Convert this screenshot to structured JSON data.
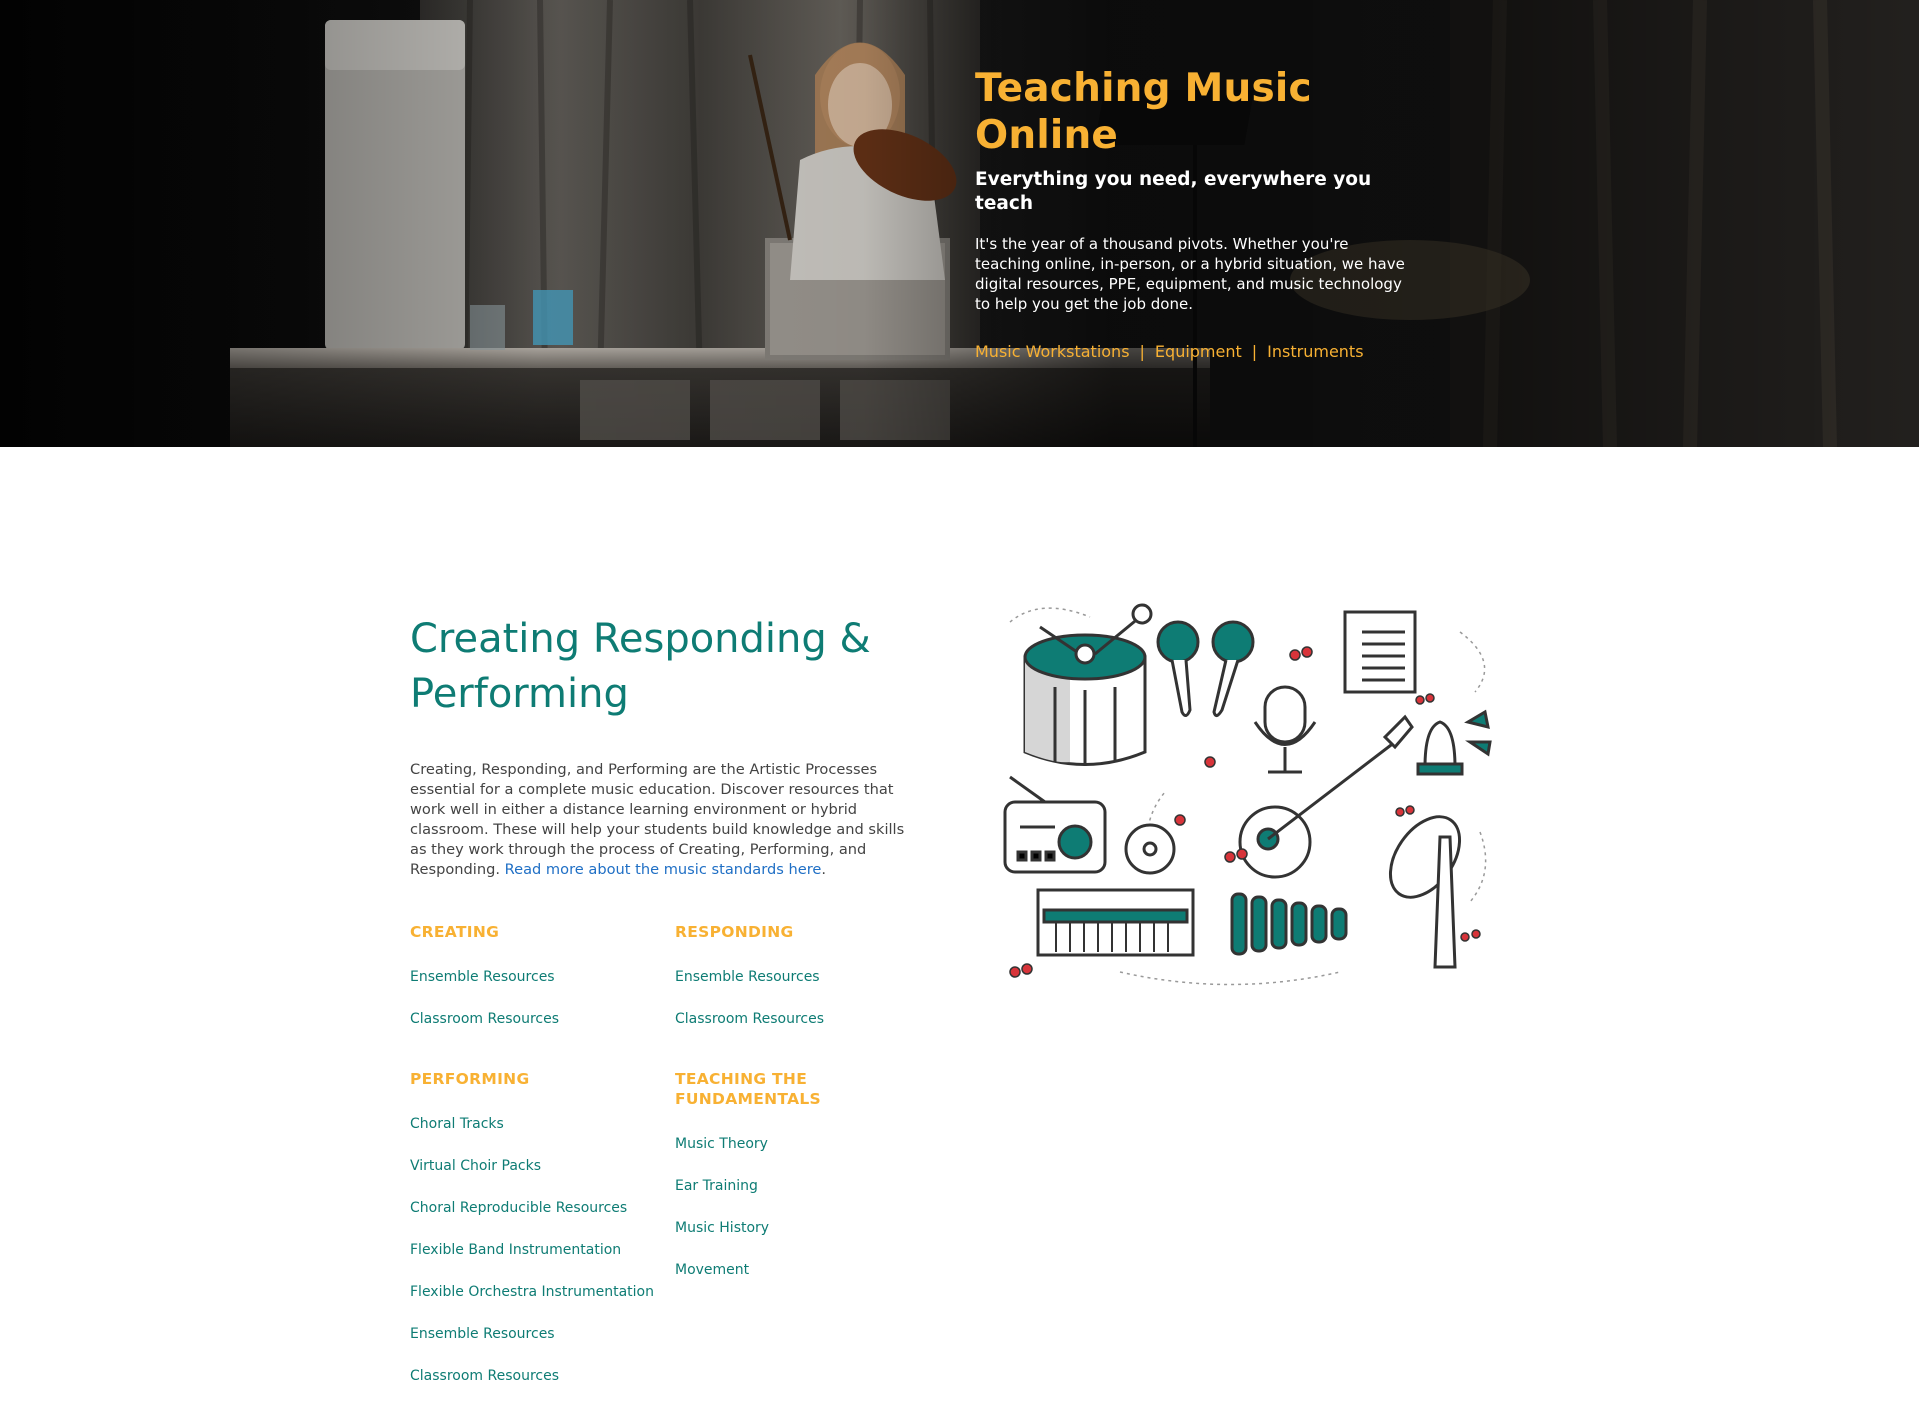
{
  "hero": {
    "title": "Teaching Music Online",
    "subtitle": "Everything you need, everywhere you teach",
    "description": "It's the year of a thousand pivots. Whether you're teaching online, in-person, or a hybrid situation, we have digital resources, PPE, equipment, and music technology to help you get the job done.",
    "links": [
      "Music Workstations",
      "Equipment",
      "Instruments"
    ],
    "separator": "|",
    "accent_color": "#f8b133"
  },
  "section": {
    "title": "Creating Responding & Performing",
    "description_text": "Creating, Responding, and Performing are the Artistic Processes essential for a complete music education. Discover resources that work well in either a distance learning environment or hybrid classroom. These will help your students build knowledge and skills as they work through the process of Creating, Performing, and Responding. ",
    "description_link": "Read more about the music standards here",
    "description_end": ".",
    "title_color": "#0e7c74"
  },
  "categories": {
    "creating": {
      "heading": "CREATING",
      "items": [
        "Ensemble Resources",
        "Classroom Resources"
      ]
    },
    "responding": {
      "heading": "RESPONDING",
      "items": [
        "Ensemble Resources",
        "Classroom Resources"
      ]
    },
    "performing": {
      "heading": "PERFORMING",
      "items": [
        "Choral Tracks",
        "Virtual Choir Packs",
        "Choral Reproducible Resources",
        "Flexible Band Instrumentation",
        "Flexible Orchestra Instrumentation",
        "Ensemble Resources",
        "Classroom Resources"
      ]
    },
    "fundamentals": {
      "heading": "TEACHING THE FUNDAMENTALS",
      "items": [
        "Music Theory",
        "Ear Training",
        "Music History",
        "Movement"
      ]
    }
  },
  "illustration": {
    "icon": "music-instruments-illustration",
    "primary_color": "#0e7c74",
    "accent_color": "#d8343a"
  }
}
